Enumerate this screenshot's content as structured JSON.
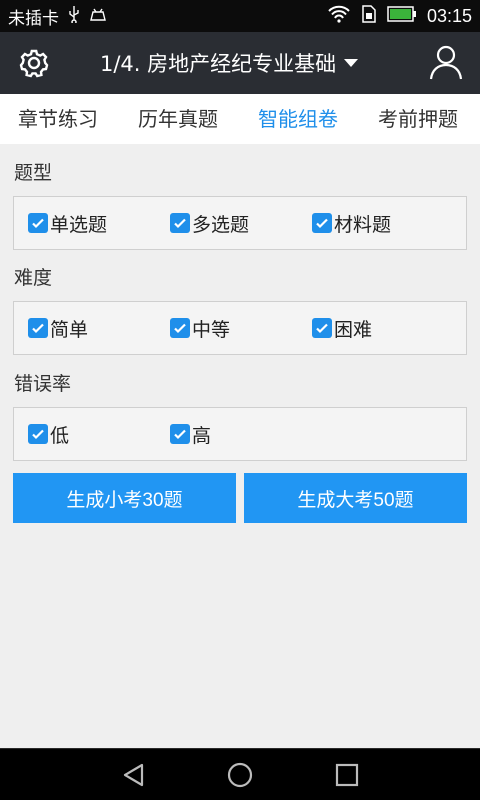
{
  "status": {
    "carrier": "未插卡",
    "time": "03:15",
    "icons": [
      "usb-icon",
      "android-debug-icon",
      "wifi-icon",
      "sim-icon",
      "battery-icon"
    ]
  },
  "header": {
    "title": "1/4. 房地产经纪专业基础",
    "icons": [
      "gear-icon",
      "chevron-down-icon",
      "user-icon"
    ]
  },
  "tabs": [
    {
      "label": "章节练习"
    },
    {
      "label": "历年真题"
    },
    {
      "label": "智能组卷"
    },
    {
      "label": "考前押题"
    }
  ],
  "active_tab": 2,
  "sections": [
    {
      "title": "题型",
      "options": [
        {
          "label": "单选题",
          "checked": true
        },
        {
          "label": "多选题",
          "checked": true
        },
        {
          "label": "材料题",
          "checked": true
        }
      ]
    },
    {
      "title": "难度",
      "options": [
        {
          "label": "简单",
          "checked": true
        },
        {
          "label": "中等",
          "checked": true
        },
        {
          "label": "困难",
          "checked": true
        }
      ]
    },
    {
      "title": "错误率",
      "options": [
        {
          "label": "低",
          "checked": true
        },
        {
          "label": "高",
          "checked": true
        }
      ]
    }
  ],
  "buttons": {
    "small_exam": "生成小考30题",
    "big_exam": "生成大考50题"
  },
  "colors": {
    "accent": "#1f8fea",
    "button": "#2196f3",
    "header_bg": "#2a2d33"
  }
}
